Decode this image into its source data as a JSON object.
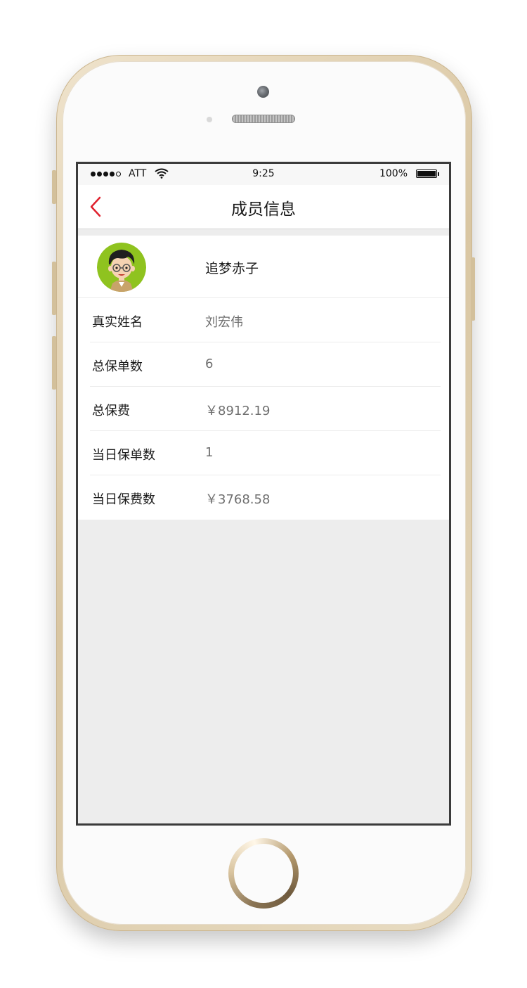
{
  "status_bar": {
    "carrier": "ATT",
    "time": "9:25",
    "battery": "100%"
  },
  "nav": {
    "title": "成员信息",
    "back_icon": "chevron-left-icon",
    "accent_color": "#e0212e"
  },
  "profile": {
    "nickname": "追梦赤子",
    "avatar_icon": "cartoon-man-avatar"
  },
  "rows": [
    {
      "label": "真实姓名",
      "value": "刘宏伟"
    },
    {
      "label": "总保单数",
      "value": "6"
    },
    {
      "label": "总保费",
      "value": "￥8912.19"
    },
    {
      "label": "当日保单数",
      "value": "1"
    },
    {
      "label": "当日保费数",
      "value": "￥3768.58"
    }
  ]
}
